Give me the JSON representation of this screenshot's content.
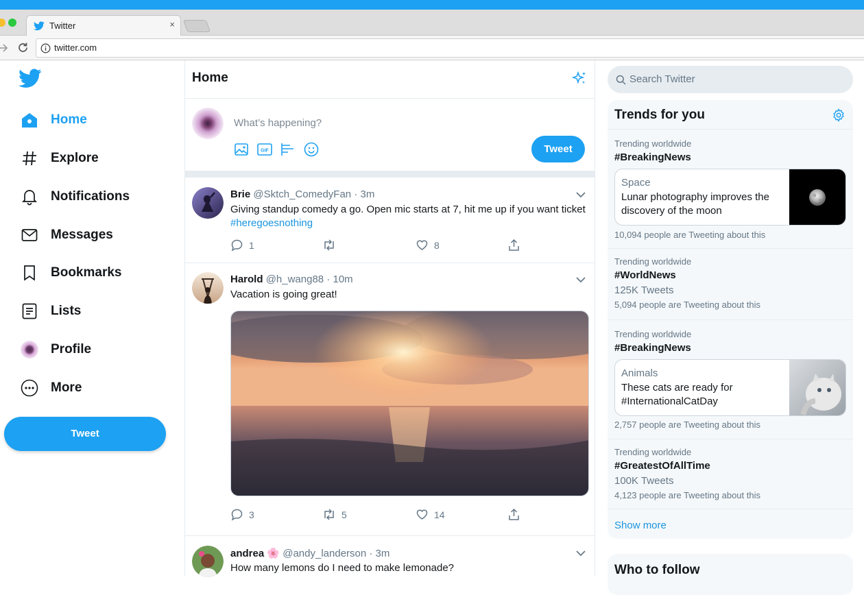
{
  "browser": {
    "tab_title": "Twitter",
    "tab_close": "×",
    "url": "twitter.com"
  },
  "nav": {
    "items": [
      {
        "label": "Home",
        "icon": "home-icon",
        "active": true
      },
      {
        "label": "Explore",
        "icon": "hashtag-icon"
      },
      {
        "label": "Notifications",
        "icon": "bell-icon"
      },
      {
        "label": "Messages",
        "icon": "envelope-icon"
      },
      {
        "label": "Bookmarks",
        "icon": "bookmark-icon"
      },
      {
        "label": "Lists",
        "icon": "list-icon"
      },
      {
        "label": "Profile",
        "icon": "avatar"
      },
      {
        "label": "More",
        "icon": "more-icon"
      }
    ],
    "tweet_button": "Tweet"
  },
  "home": {
    "title": "Home",
    "compose_placeholder": "What’s happening?",
    "compose_button": "Tweet"
  },
  "tweets": [
    {
      "name": "Brie",
      "handle": "@Sktch_ComedyFan",
      "time": " · 3m",
      "text": "Giving standup comedy a go. Open mic starts at 7, hit me up if you want ticket ",
      "hashtag": "#heregoesnothing",
      "replies": "1",
      "retweets": "",
      "likes": "8"
    },
    {
      "name": "Harold",
      "handle": "@h_wang88",
      "time": " · 10m",
      "text": "Vacation is going great!",
      "replies": "3",
      "retweets": "5",
      "likes": "14"
    },
    {
      "name": "andrea",
      "emoji": "🌸",
      "handle": "@andy_landerson",
      "time": " · 3m",
      "text": "How many lemons do I need to make lemonade?"
    }
  ],
  "sidebar": {
    "search_placeholder": "Search Twitter",
    "trends_title": "Trends for you",
    "trends": [
      {
        "meta": "Trending worldwide",
        "tag": "#BreakingNews",
        "card_category": "Space",
        "card_text": "Lunar photography improves the discovery of the moon",
        "people": "10,094 people are Tweeting about this"
      },
      {
        "meta": "Trending worldwide",
        "tag": "#WorldNews",
        "count": "125K Tweets",
        "people": "5,094 people are Tweeting about this"
      },
      {
        "meta": "Trending worldwide",
        "tag": "#BreakingNews",
        "card_category": "Animals",
        "card_text": "These cats are ready for #InternationalCatDay",
        "people": "2,757 people are Tweeting about this"
      },
      {
        "meta": "Trending worldwide",
        "tag": "#GreatestOfAllTime",
        "count": "100K Tweets",
        "people": "4,123 people are Tweeting about this"
      }
    ],
    "show_more": "Show more",
    "who_to_follow": "Who to follow"
  },
  "colors": {
    "accent": "#1da1f2",
    "link": "#1b95e0",
    "text": "#14171a",
    "muted": "#657786"
  }
}
